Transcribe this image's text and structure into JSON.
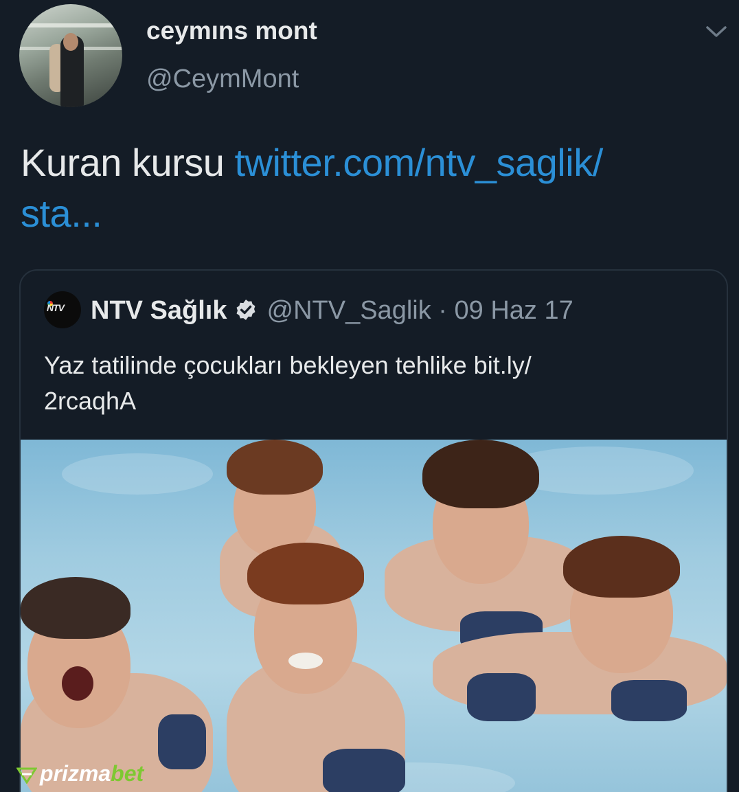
{
  "tweet": {
    "author": {
      "display_name": "ceymıns mont",
      "handle": "@CeymMont"
    },
    "text": "Kuran kursu",
    "link_text": "twitter.com/ntv_saglik/",
    "link_text_cont": "sta..."
  },
  "quoted_tweet": {
    "avatar_label": "NTV",
    "display_name": "NTV Sağlık",
    "verified": true,
    "handle": "@NTV_Saglik",
    "separator": "·",
    "date": "09 Haz 17",
    "text_line1": "Yaz tatilinde çocukları bekleyen tehlike bit.ly/",
    "text_line2": "2rcaqhA"
  },
  "watermark": {
    "part1": "prizma",
    "part2": "bet"
  },
  "colors": {
    "background": "#141c26",
    "link": "#2b8fd6",
    "secondary_text": "#8b98a5",
    "primary_text": "#e7e9ea",
    "watermark_accent": "#7ec832"
  },
  "icons": [
    "chevron-down-icon",
    "verified-badge-icon",
    "prizmabet-logo-icon"
  ]
}
